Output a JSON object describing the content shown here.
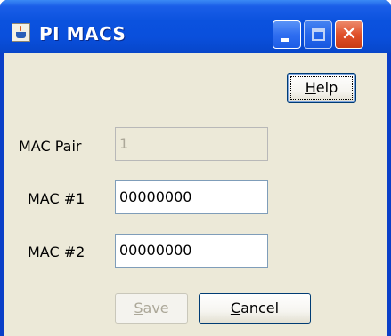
{
  "window": {
    "title": "PI MACS",
    "controls": {
      "minimize_icon": "minimize-icon",
      "maximize_icon": "maximize-icon",
      "close_icon": "close-icon",
      "close_glyph": "✕"
    }
  },
  "buttons": {
    "help": {
      "label_prefix": "",
      "label_mnemonic": "H",
      "label_rest": "elp"
    },
    "save": {
      "label_prefix": "",
      "label_mnemonic": "S",
      "label_rest": "ave",
      "enabled": false
    },
    "cancel": {
      "label_prefix": "",
      "label_mnemonic": "C",
      "label_rest": "ancel"
    }
  },
  "form": {
    "mac_pair": {
      "label": "MAC Pair",
      "value": "1",
      "enabled": false
    },
    "mac1": {
      "label": "MAC #1",
      "value": "00000000"
    },
    "mac2": {
      "label": "MAC #2",
      "value": "00000000"
    }
  },
  "colors": {
    "titlebar": "#0a4fdc",
    "client_bg": "#ece9d8",
    "close_button": "#e0502a"
  }
}
